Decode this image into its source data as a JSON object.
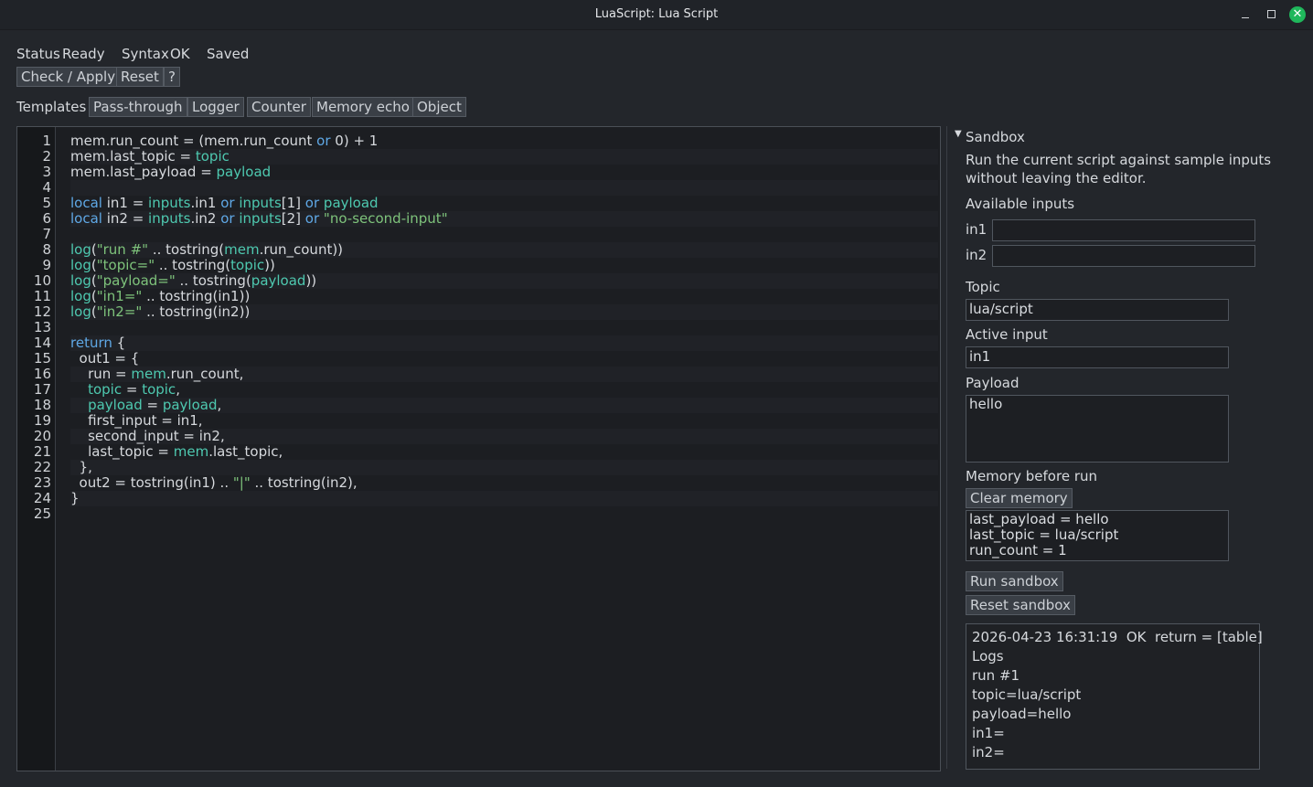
{
  "window": {
    "title": "LuaScript: Lua Script"
  },
  "status": {
    "status_label": "Status",
    "status_value": "Ready",
    "syntax_label": "Syntax",
    "syntax_value": "OK",
    "saved": "Saved"
  },
  "actions": {
    "check_apply": "Check / Apply",
    "reset": "Reset",
    "help": "?"
  },
  "templates": {
    "label": "Templates",
    "items": [
      "Pass-through",
      "Logger",
      "Counter",
      "Memory echo",
      "Object"
    ]
  },
  "editor": {
    "line_numbers": [
      "1",
      "2",
      "3",
      "4",
      "5",
      "6",
      "7",
      "8",
      "9",
      "10",
      "11",
      "12",
      "13",
      "14",
      "15",
      "16",
      "17",
      "18",
      "19",
      "20",
      "21",
      "22",
      "23",
      "24",
      "25"
    ]
  },
  "sandbox": {
    "header": "Sandbox",
    "description_line1": "Run the current script against sample inputs",
    "description_line2": "without leaving the editor.",
    "available_inputs_label": "Available inputs",
    "in1_label": "in1",
    "in1_value": "",
    "in2_label": "in2",
    "in2_value": "",
    "topic_label": "Topic",
    "topic_value": "lua/script",
    "active_input_label": "Active input",
    "active_input_value": "in1",
    "payload_label": "Payload",
    "payload_value": "hello",
    "memory_label": "Memory before run",
    "clear_memory": "Clear memory",
    "memory_lines": [
      "last_payload = hello",
      "last_topic = lua/script",
      "run_count = 1"
    ],
    "run_button": "Run sandbox",
    "reset_button": "Reset sandbox",
    "result": {
      "summary": "2026-04-23 16:31:19  OK  return = [table]",
      "logs_label": "Logs",
      "log_lines": [
        "run #1",
        "topic=lua/script",
        "payload=hello",
        "in1=",
        "in2="
      ]
    }
  }
}
